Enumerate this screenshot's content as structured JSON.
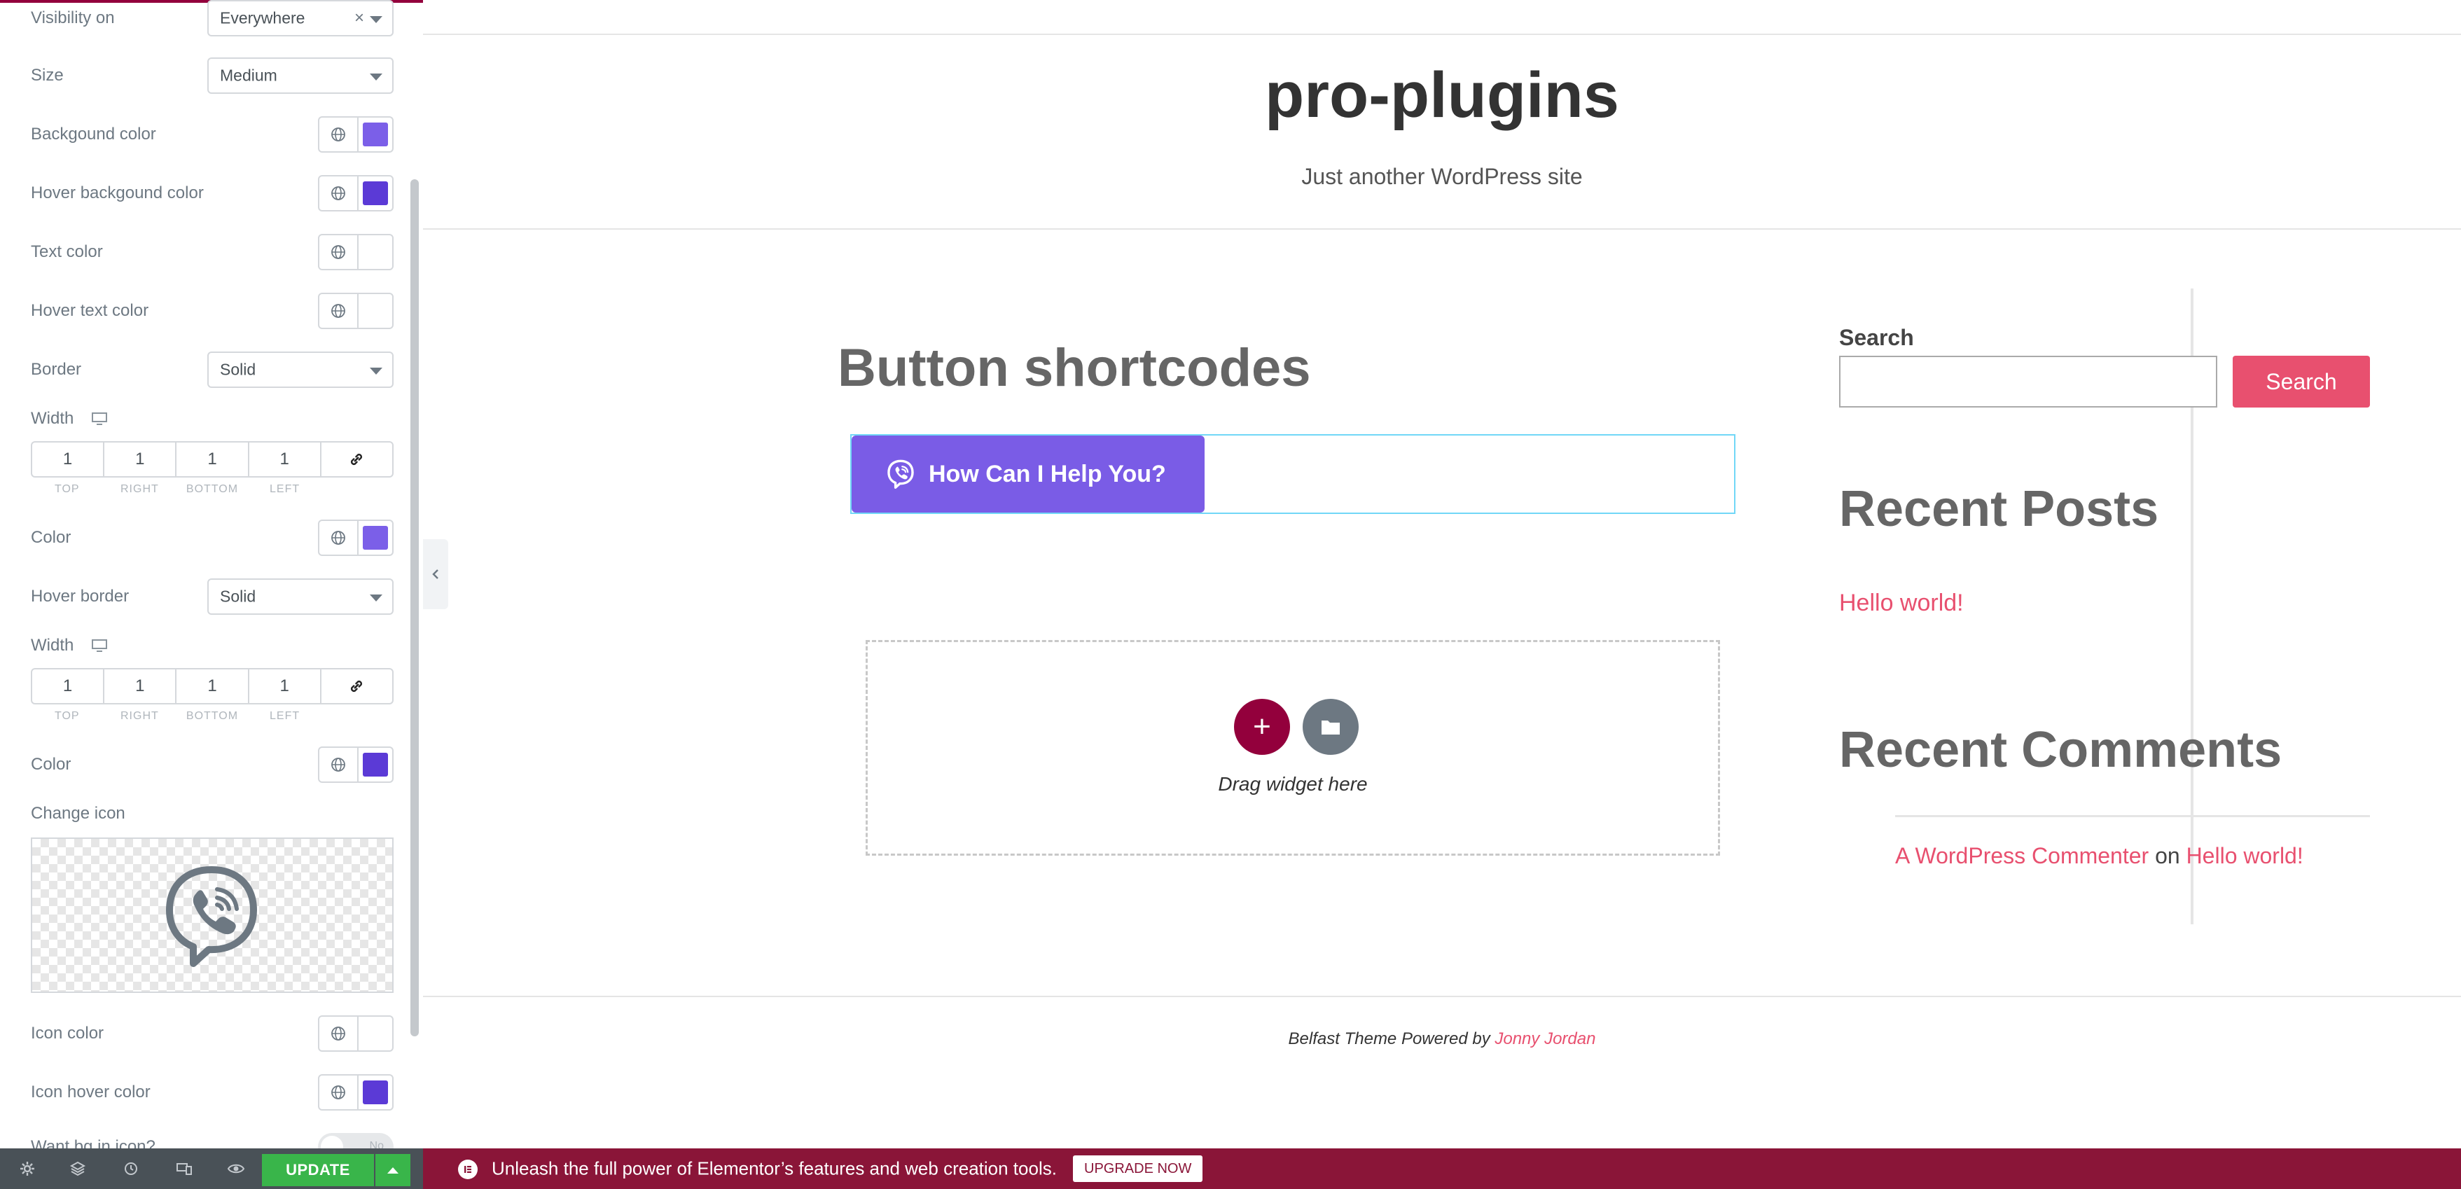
{
  "panel": {
    "visibility": {
      "label": "Visibility on",
      "value": "Everywhere",
      "clear": "×"
    },
    "size": {
      "label": "Size",
      "value": "Medium"
    },
    "bg_color": {
      "label": "Backgound color",
      "color": "#7b5fe8"
    },
    "hover_bg_color": {
      "label": "Hover backgound color",
      "color": "#5b3ad6"
    },
    "text_color": {
      "label": "Text color",
      "color": "#ffffff"
    },
    "hover_text_color": {
      "label": "Hover text color",
      "color": "#ffffff"
    },
    "border": {
      "label": "Border",
      "value": "Solid"
    },
    "width1": {
      "label": "Width",
      "top": "1",
      "right": "1",
      "bottom": "1",
      "left": "1"
    },
    "color1": {
      "label": "Color",
      "color": "#7b5fe8"
    },
    "hover_border": {
      "label": "Hover border",
      "value": "Solid"
    },
    "width2": {
      "label": "Width",
      "top": "1",
      "right": "1",
      "bottom": "1",
      "left": "1"
    },
    "color2": {
      "label": "Color",
      "color": "#5b3ad6"
    },
    "change_icon": {
      "label": "Change icon"
    },
    "icon_color": {
      "label": "Icon color",
      "color": "#ffffff"
    },
    "icon_hover_color": {
      "label": "Icon hover color",
      "color": "#5b3ad6"
    },
    "want_bg": {
      "label": "Want bg in icon?",
      "toggle_text": "No"
    },
    "dim_labels": {
      "top": "TOP",
      "right": "RIGHT",
      "bottom": "BOTTOM",
      "left": "LEFT"
    }
  },
  "toolbar": {
    "update_label": "UPDATE"
  },
  "site": {
    "title": "pro-plugins",
    "description": "Just another WordPress site",
    "page_heading": "Button shortcodes",
    "help_button": "How Can I Help You?",
    "drag_text": "Drag widget here",
    "search_label": "Search",
    "search_button": "Search",
    "recent_posts": "Recent Posts",
    "recent_post_link": "Hello world!",
    "recent_comments": "Recent Comments",
    "commenter": "A WordPress Commenter",
    "on_text": "on",
    "comment_post": "Hello world!",
    "footer_prefix": "Belfast Theme Powered by",
    "footer_link": "Jonny Jordan"
  },
  "promo": {
    "message": "Unleash the full power of Elementor’s features and web creation tools.",
    "upgrade": "UPGRADE NOW"
  },
  "colors": {
    "accent": "#93003c",
    "brand_purple": "#7a5ce6",
    "link": "#e8506f",
    "update_green": "#39b54a"
  }
}
